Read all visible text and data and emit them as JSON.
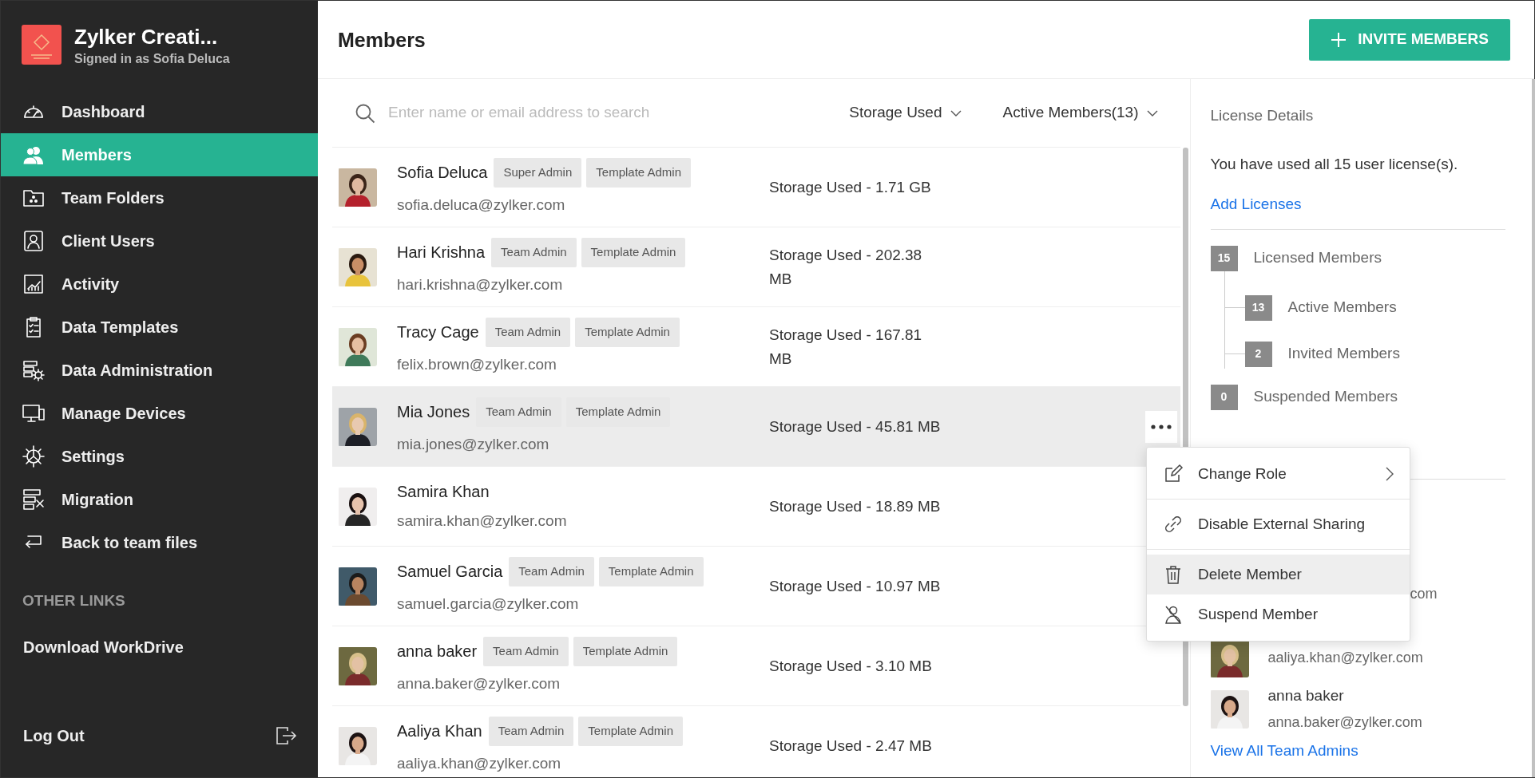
{
  "sidebar": {
    "org_name": "Zylker Creati...",
    "signed_in": "Signed in as Sofia Deluca",
    "items": [
      {
        "label": "Dashboard",
        "selected": false
      },
      {
        "label": "Members",
        "selected": true
      },
      {
        "label": "Team Folders",
        "selected": false
      },
      {
        "label": "Client Users",
        "selected": false
      },
      {
        "label": "Activity",
        "selected": false
      },
      {
        "label": "Data Templates",
        "selected": false
      },
      {
        "label": "Data Administration",
        "selected": false
      },
      {
        "label": "Manage Devices",
        "selected": false
      },
      {
        "label": "Settings",
        "selected": false
      },
      {
        "label": "Migration",
        "selected": false
      },
      {
        "label": "Back to team files",
        "selected": false
      }
    ],
    "other_links_heading": "OTHER LINKS",
    "other_links": [
      "Download WorkDrive"
    ],
    "logout": "Log Out"
  },
  "header": {
    "title": "Members",
    "invite_button": "INVITE MEMBERS"
  },
  "toolbar": {
    "search_placeholder": "Enter name or email address to search",
    "filters": [
      "Storage Used",
      "Active Members(13)"
    ]
  },
  "members": [
    {
      "name": "Sofia Deluca",
      "roles": [
        "Super Admin",
        "Template Admin"
      ],
      "email": "sofia.deluca@zylker.com",
      "storage": "Storage Used - 1.71 GB",
      "selected": false
    },
    {
      "name": "Hari Krishna",
      "roles": [
        "Team Admin",
        "Template Admin"
      ],
      "email": "hari.krishna@zylker.com",
      "storage": "Storage Used - 202.38 MB",
      "selected": false
    },
    {
      "name": "Tracy Cage",
      "roles": [
        "Team Admin",
        "Template Admin"
      ],
      "email": "felix.brown@zylker.com",
      "storage": "Storage Used - 167.81 MB",
      "selected": false
    },
    {
      "name": "Mia Jones",
      "roles": [
        "Team Admin",
        "Template Admin"
      ],
      "email": "mia.jones@zylker.com",
      "storage": "Storage Used - 45.81 MB",
      "selected": true
    },
    {
      "name": "Samira Khan",
      "email": "samira.khan@zylker.com",
      "storage": "Storage Used - 18.89 MB",
      "selected": false
    },
    {
      "name": "Samuel Garcia",
      "roles": [
        "Team Admin",
        "Template Admin"
      ],
      "email": "samuel.garcia@zylker.com",
      "storage": "Storage Used - 10.97 MB",
      "selected": false
    },
    {
      "name": "anna baker",
      "roles": [
        "Team Admin",
        "Template Admin"
      ],
      "email": "anna.baker@zylker.com",
      "storage": "Storage Used - 3.10 MB",
      "selected": false
    },
    {
      "name": "Aaliya Khan",
      "roles": [
        "Team Admin",
        "Template Admin"
      ],
      "email": "aaliya.khan@zylker.com",
      "storage": "Storage Used - 2.47 MB",
      "selected": false
    }
  ],
  "context_menu": {
    "items": [
      {
        "label": "Change Role",
        "kind": "submenu",
        "highlighted": false
      },
      {
        "label": "Disable External Sharing",
        "kind": "action",
        "highlighted": false
      },
      {
        "label": "Delete Member",
        "kind": "action",
        "highlighted": true
      },
      {
        "label": "Suspend Member",
        "kind": "action",
        "highlighted": false
      }
    ]
  },
  "license": {
    "title": "License Details",
    "usage": "You have used all 15 user license(s).",
    "link": "Add Licenses",
    "counts": [
      {
        "count": "15",
        "label": "Licensed Members",
        "children": [
          {
            "count": "13",
            "label": "Active Members"
          },
          {
            "count": "2",
            "label": "Invited Members"
          }
        ]
      },
      {
        "count": "0",
        "label": "Suspended Members"
      }
    ]
  },
  "team_admins": {
    "items": [
      {
        "email": "com"
      },
      {
        "email": "aaliya.khan@zylker.com",
        "kind": "picture"
      },
      {
        "name": "anna baker",
        "email": "anna.baker@zylker.com",
        "kind": "picture"
      }
    ],
    "link": "View All Team Admins"
  }
}
